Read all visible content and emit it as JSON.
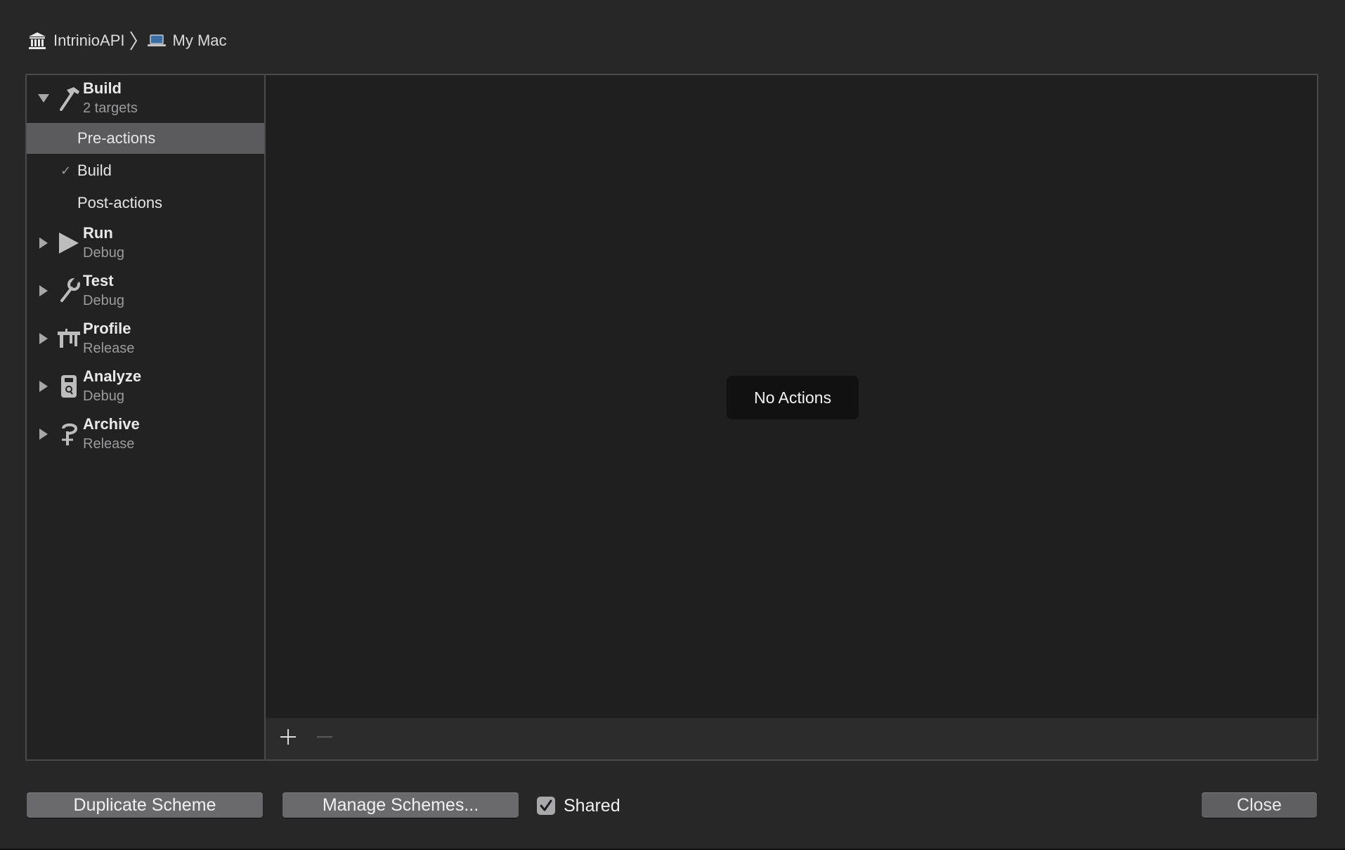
{
  "breadcrumb": {
    "project": {
      "label": "IntrinioAPI",
      "icon": "project-building-icon"
    },
    "separator_icon": "chevron-right-icon",
    "destination": {
      "label": "My Mac",
      "icon": "laptop-icon"
    }
  },
  "sidebar": {
    "groups": [
      {
        "key": "build",
        "title": "Build",
        "subtitle": "2 targets",
        "icon": "hammer-icon",
        "expanded": true
      },
      {
        "key": "run",
        "title": "Run",
        "subtitle": "Debug",
        "icon": "play-icon",
        "expanded": false
      },
      {
        "key": "test",
        "title": "Test",
        "subtitle": "Debug",
        "icon": "wrench-icon",
        "expanded": false
      },
      {
        "key": "profile",
        "title": "Profile",
        "subtitle": "Release",
        "icon": "caliper-icon",
        "expanded": false
      },
      {
        "key": "analyze",
        "title": "Analyze",
        "subtitle": "Debug",
        "icon": "analyze-icon",
        "expanded": false
      },
      {
        "key": "archive",
        "title": "Archive",
        "subtitle": "Release",
        "icon": "archive-icon",
        "expanded": false
      }
    ],
    "build_subitems": [
      {
        "label": "Pre-actions",
        "selected": true,
        "checked": false
      },
      {
        "label": "Build",
        "selected": false,
        "checked": true,
        "check_glyph": "✓"
      },
      {
        "label": "Post-actions",
        "selected": false,
        "checked": false
      }
    ]
  },
  "content": {
    "empty_message": "No Actions",
    "footer": {
      "add_icon": "plus-icon",
      "remove_icon": "minus-icon"
    }
  },
  "bottom_bar": {
    "duplicate_label": "Duplicate Scheme",
    "manage_label": "Manage Schemes...",
    "shared_label": "Shared",
    "shared_checked": true,
    "close_label": "Close"
  },
  "colors": {
    "window_bg": "#272728",
    "panel_bg": "#1f1f20",
    "selection_bg": "#5b5b5d",
    "button_bg": "#6a6a6c",
    "text_primary": "#e9e9e9",
    "text_secondary": "#9b9b9d"
  }
}
